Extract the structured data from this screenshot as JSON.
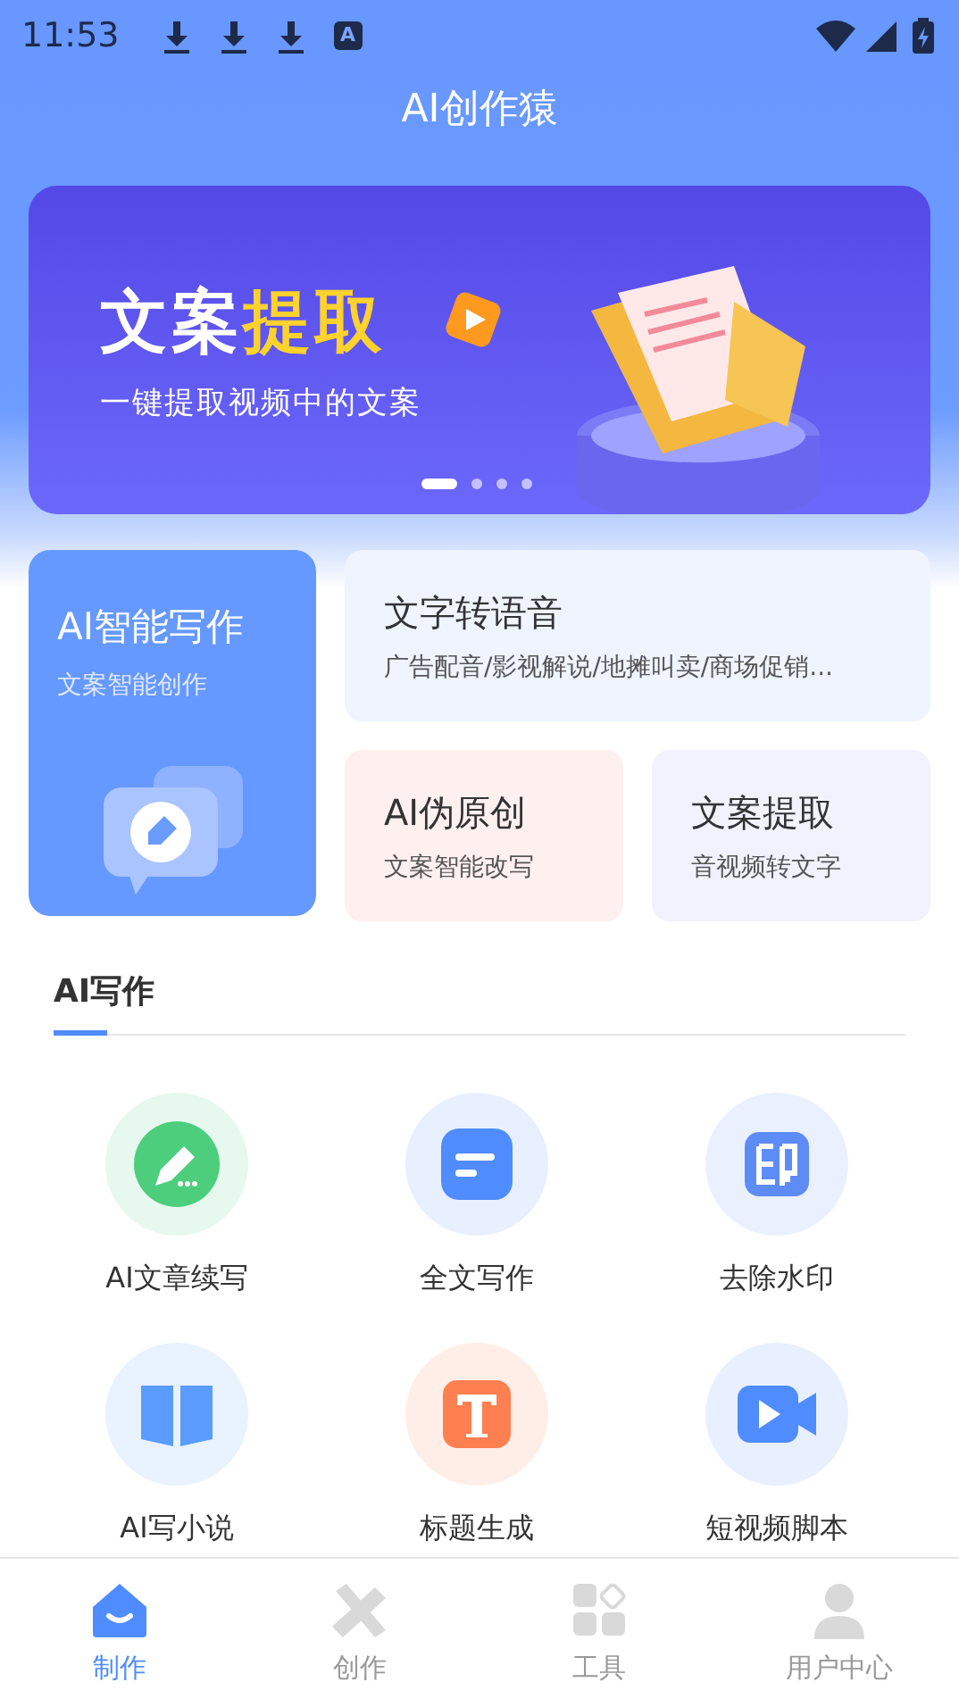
{
  "status_bar": {
    "time": "11:53",
    "notifications": [
      {
        "kind": "download"
      },
      {
        "kind": "download"
      },
      {
        "kind": "download"
      },
      {
        "kind": "app",
        "glyph": "A"
      }
    ]
  },
  "app_bar": {
    "title": "AI创作猿"
  },
  "banner": {
    "title": "文案",
    "title_highlight": "提取",
    "subtitle": "一键提取视频中的文案",
    "dots": [
      {
        "selected": true
      },
      {
        "selected": false
      },
      {
        "selected": false
      },
      {
        "selected": false
      }
    ]
  },
  "main_card": {
    "title": "AI智能写作",
    "subtitle": "文案智能创作"
  },
  "feature_cards": [
    {
      "title": "文字转语音",
      "subtitle": "广告配音/影视解说/地摊叫卖/商场促销...",
      "color": "#eff4ff",
      "wide": true
    },
    {
      "title": "AI伪原创",
      "subtitle": "文案智能改写",
      "color": "#fff0f0",
      "wide": false
    },
    {
      "title": "文案提取",
      "subtitle": "音视频转文字",
      "color": "#f1f2fd",
      "wide": false
    }
  ],
  "section_tabs": [
    {
      "label": "AI写作",
      "selected": true
    }
  ],
  "tools": [
    {
      "label": "AI文章续写",
      "kind": "pencil",
      "color": "#4cce7d"
    },
    {
      "label": "全文写作",
      "kind": "document",
      "color": "#4f8cff"
    },
    {
      "label": "去除水印",
      "kind": "stamp",
      "color": "#5e8cf7"
    },
    {
      "label": "AI写小说",
      "kind": "book",
      "color": "#5a9cff"
    },
    {
      "label": "标题生成",
      "kind": "text",
      "color": "#ff7f50"
    },
    {
      "label": "短视频脚本",
      "kind": "video",
      "color": "#4f8cff"
    }
  ],
  "bottom_nav": [
    {
      "label": "制作",
      "kind": "home",
      "selected": true
    },
    {
      "label": "创作",
      "kind": "ruler",
      "selected": false
    },
    {
      "label": "工具",
      "kind": "grid",
      "selected": false
    },
    {
      "label": "用户中心",
      "kind": "person",
      "selected": false
    }
  ]
}
